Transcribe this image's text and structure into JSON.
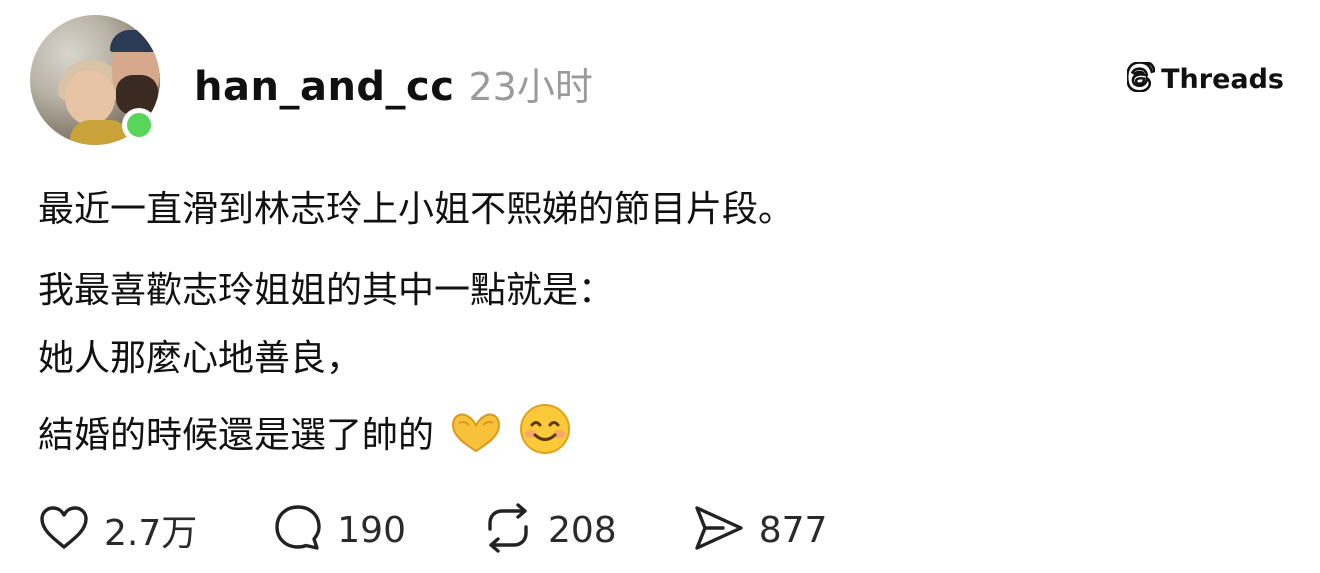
{
  "post": {
    "username": "han_and_cc",
    "time": "23小时",
    "brand": "Threads",
    "lines": [
      "最近一直滑到林志玲上小姐不熙娣的節目片段。",
      "我最喜歡志玲姐姐的其中一點就是：",
      "她人那麼心地善良，",
      "結婚的時候還是選了帥的"
    ],
    "emojis": [
      "heart-hands-emoji",
      "smiling-face-emoji"
    ]
  },
  "stats": {
    "likes": "2.7万",
    "comments": "190",
    "reposts": "208",
    "shares": "877"
  },
  "colors": {
    "status": "#57d65a",
    "muted": "#9a9a9a",
    "text": "#111111"
  }
}
